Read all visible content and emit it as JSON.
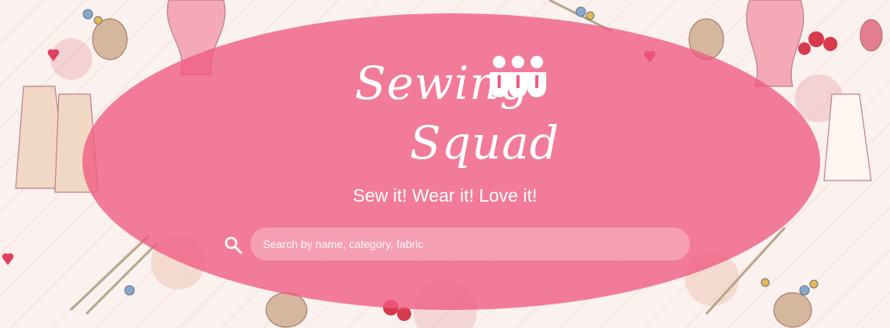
{
  "header": {
    "logo": {
      "word1": "Sewing",
      "word2": "Squad",
      "icon": "team-icon"
    },
    "tagline": "Sew it! Wear it! Love it!"
  },
  "search": {
    "icon": "search-icon",
    "placeholder": "Search by name, category, fabric",
    "value": ""
  },
  "colors": {
    "accent": "#f05a82",
    "text": "#ffffff",
    "background": "#fbf1ee"
  }
}
